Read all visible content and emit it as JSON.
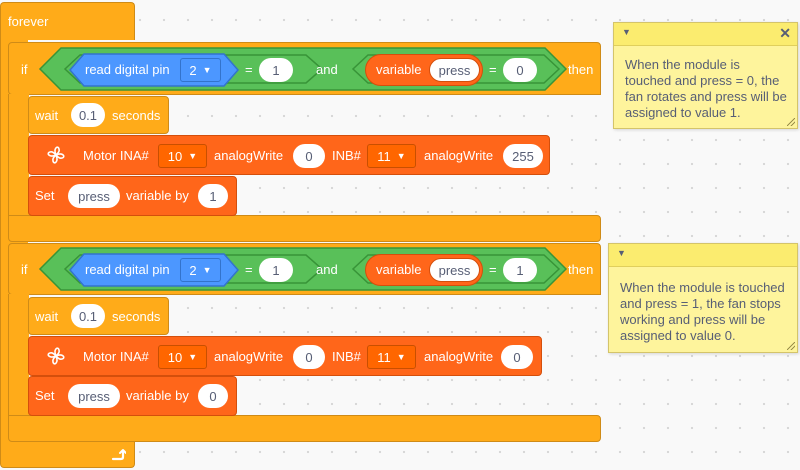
{
  "forever_label": "forever",
  "if1": {
    "if_label": "if",
    "then_label": "then",
    "pin_label": "read digital pin",
    "pin_value": "2",
    "eq1": "=",
    "eq1_value": "1",
    "and_label": "and",
    "var_label": "variable",
    "var_name": "press",
    "eq2": "=",
    "eq2_value": "0"
  },
  "wait1": {
    "label": "wait",
    "value": "0.1",
    "suffix": "seconds"
  },
  "motor1": {
    "label": "Motor INA#",
    "ina": "10",
    "aw1": "analogWrite",
    "aw1_value": "0",
    "inb_label": "INB#",
    "inb": "11",
    "aw2": "analogWrite",
    "aw2_value": "255"
  },
  "set1": {
    "label": "Set",
    "var": "press",
    "by_label": "variable by",
    "value": "1"
  },
  "if2": {
    "if_label": "if",
    "then_label": "then",
    "pin_label": "read digital pin",
    "pin_value": "2",
    "eq1": "=",
    "eq1_value": "1",
    "and_label": "and",
    "var_label": "variable",
    "var_name": "press",
    "eq2": "=",
    "eq2_value": "1"
  },
  "wait2": {
    "label": "wait",
    "value": "0.1",
    "suffix": "seconds"
  },
  "motor2": {
    "label": "Motor INA#",
    "ina": "10",
    "aw1": "analogWrite",
    "aw1_value": "0",
    "inb_label": "INB#",
    "inb": "11",
    "aw2": "analogWrite",
    "aw2_value": "0"
  },
  "set2": {
    "label": "Set",
    "var": "press",
    "by_label": "variable by",
    "value": "0"
  },
  "note1": {
    "text": "When the module is touched and press = 0, the fan rotates and press will be assigned to value 1."
  },
  "note2": {
    "text": "When the module is touched and press = 1, the fan stops working and press will be assigned to value 0."
  },
  "icons": {
    "dropdown": "caret-down-icon",
    "fan": "fan-icon",
    "close": "close-icon",
    "loop": "loop-arrow-icon"
  },
  "colors": {
    "control": "#ffab19",
    "sensing": "#4c97ff",
    "operator": "#59c059",
    "motor": "#ff661a"
  }
}
